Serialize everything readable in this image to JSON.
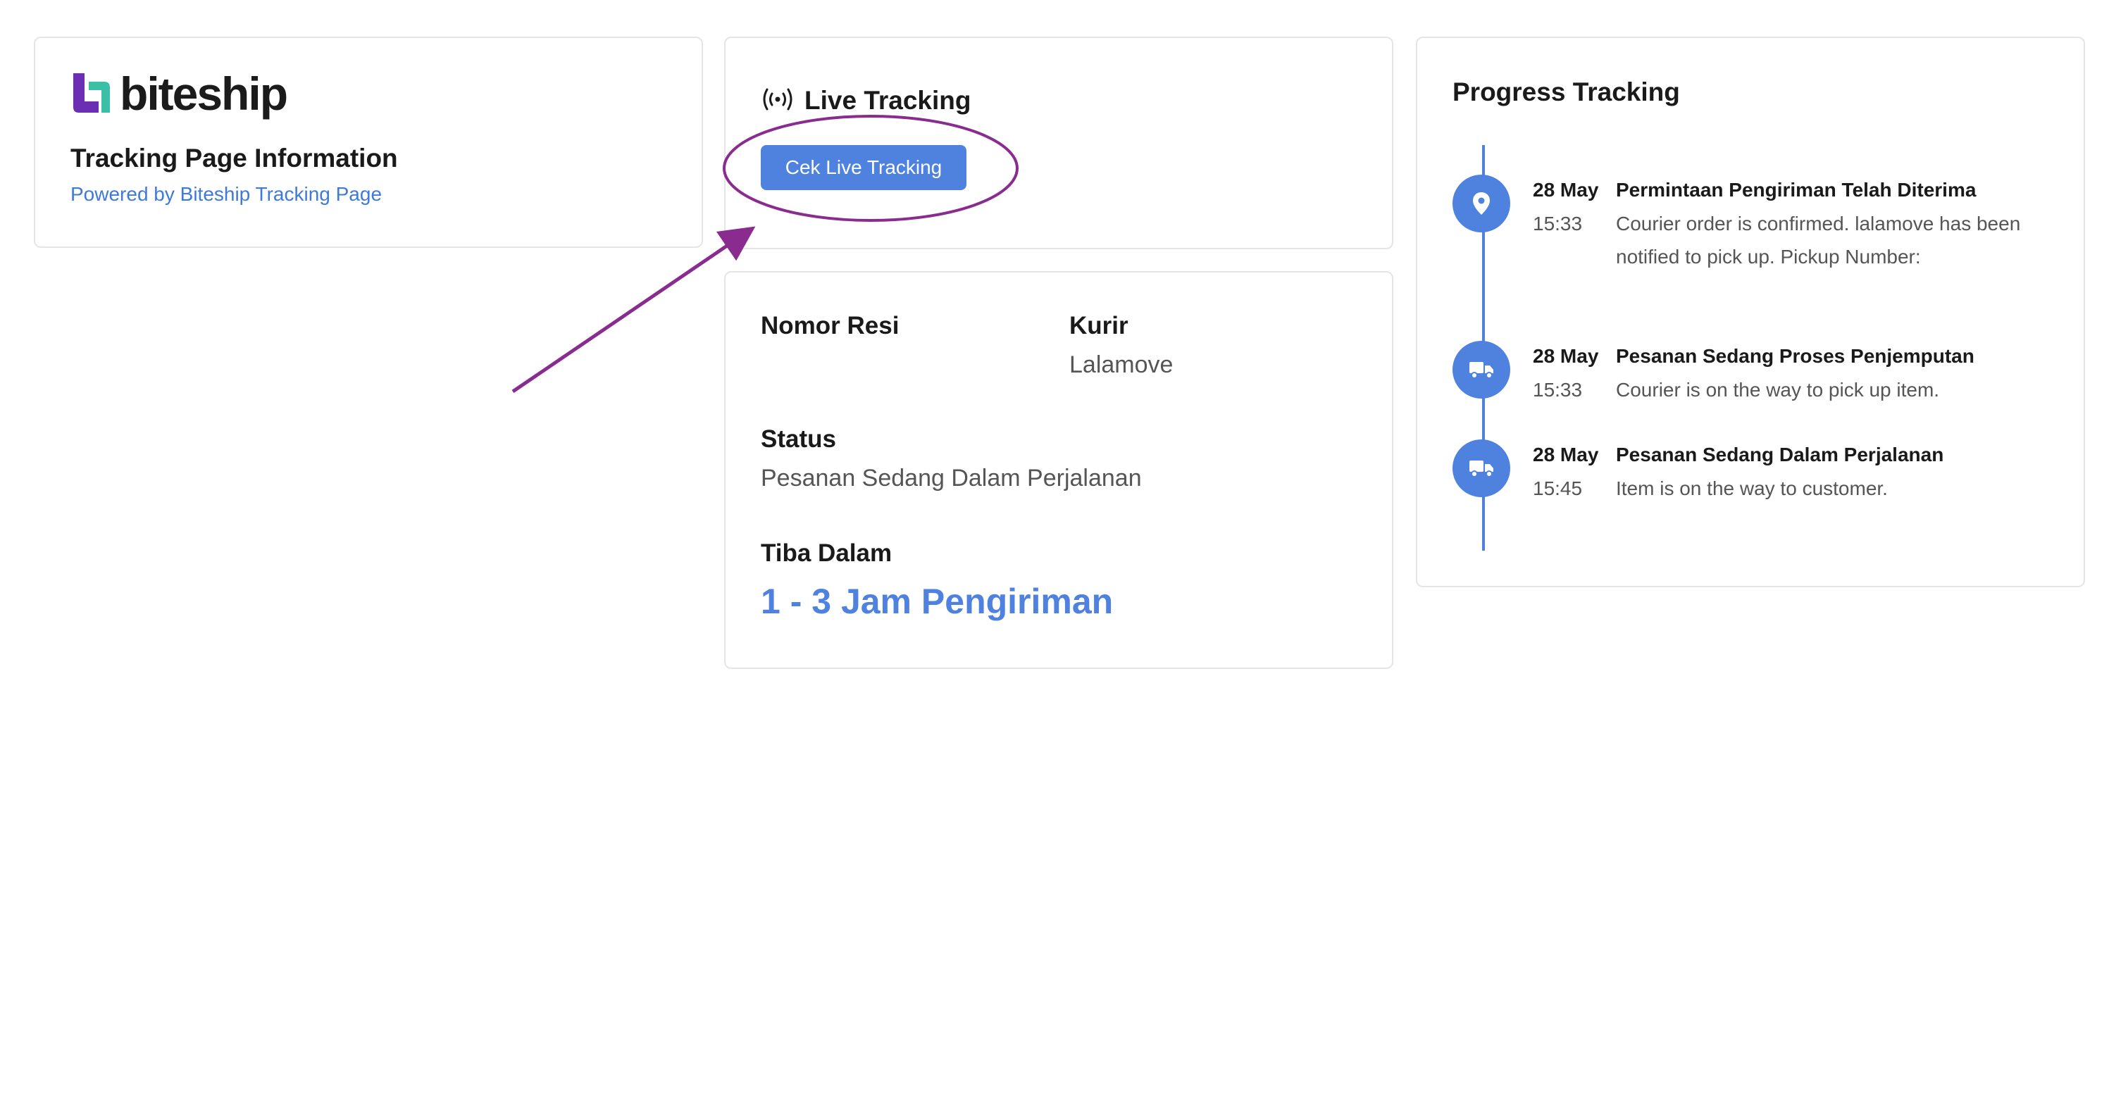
{
  "brand": {
    "name": "biteship",
    "logo_colors": {
      "purple": "#6b2fb3",
      "teal": "#3cbfa7"
    }
  },
  "info_card": {
    "title": "Tracking Page Information",
    "powered_by": "Powered by Biteship Tracking Page"
  },
  "live_tracking": {
    "icon": "broadcast-icon",
    "title": "Live Tracking",
    "button_label": "Cek Live Tracking"
  },
  "details": {
    "tracking_number_label": "Nomor Resi",
    "tracking_number_value": "",
    "courier_label": "Kurir",
    "courier_value": "Lalamove",
    "status_label": "Status",
    "status_value": "Pesanan Sedang Dalam Perjalanan",
    "eta_label": "Tiba Dalam",
    "eta_value": "1 - 3 Jam Pengiriman"
  },
  "progress": {
    "title": "Progress Tracking",
    "events": [
      {
        "icon": "location-pin-icon",
        "date": "28 May",
        "time": "15:33",
        "title": "Permintaan Pengiriman Telah Diterima",
        "description": "Courier order is confirmed. lalamove has been notified to pick up. Pickup Number:"
      },
      {
        "icon": "truck-icon",
        "date": "28 May",
        "time": "15:33",
        "title": "Pesanan Sedang Proses Penjemputan",
        "description": "Courier is on the way to pick up item."
      },
      {
        "icon": "truck-icon",
        "date": "28 May",
        "time": "15:45",
        "title": "Pesanan Sedang Dalam Perjalanan",
        "description": "Item is on the way to customer."
      }
    ]
  },
  "colors": {
    "accent": "#4f82df",
    "link": "#3f7ad8",
    "annotation": "#8a2b8f",
    "border": "#e5e5e5"
  }
}
